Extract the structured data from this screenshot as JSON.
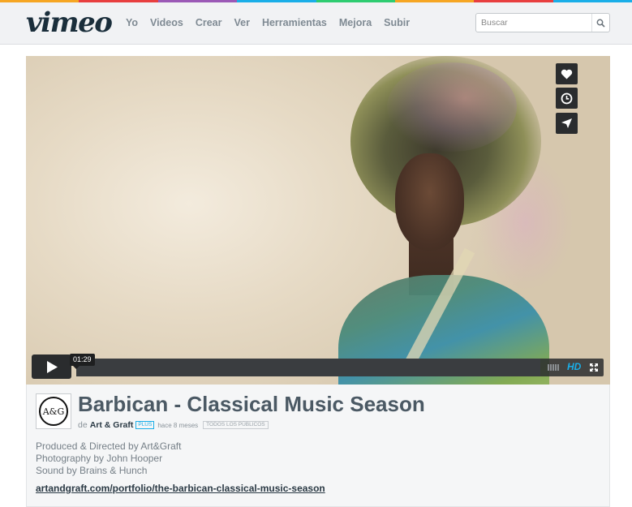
{
  "colors": {
    "topbar_bg": "#f1f2f4",
    "logo": "#1a2e3b",
    "nav": "#7f8a93",
    "accent": "#1aaee8",
    "title": "#4b5964",
    "stripe": [
      "#f6a623",
      "#e83f3f",
      "#9b59b6",
      "#1aaee8",
      "#2ecc71",
      "#f6a623",
      "#e83f3f",
      "#1aaee8"
    ]
  },
  "header": {
    "logo": "vimeo",
    "nav": [
      "Yo",
      "Videos",
      "Crear",
      "Ver",
      "Herramientas",
      "Mejora",
      "Subir"
    ],
    "search": {
      "placeholder": "Buscar",
      "icon": "search-icon"
    }
  },
  "player": {
    "side_buttons": [
      "heart-icon",
      "clock-icon",
      "send-icon"
    ],
    "play_icon": "play-icon",
    "time": "01:29",
    "hd_label": "HD",
    "progress": 0.0,
    "fullscreen_icon": "fullscreen-icon"
  },
  "video": {
    "avatar_text": "A&G",
    "title": "Barbican - Classical Music Season",
    "by_prefix": "de",
    "author": "Art & Graft",
    "plus_badge": "PLUS",
    "uploaded": "hace 8 meses",
    "rating": "TODOS LOS PÚBLICOS",
    "description": [
      "Produced & Directed by Art&Graft",
      "Photography by John Hooper",
      "Sound by Brains & Hunch"
    ],
    "link": "artandgraft.com/portfolio/the-barbican-classical-music-season"
  }
}
